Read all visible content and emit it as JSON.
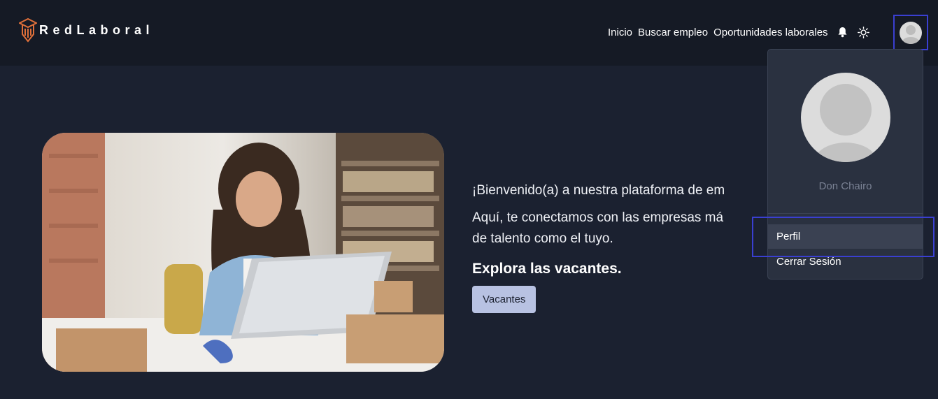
{
  "brand": {
    "name": "RedLaboral"
  },
  "nav": {
    "links": [
      "Inicio",
      "Buscar empleo",
      "Oportunidades laborales"
    ],
    "icons": [
      "bell-icon",
      "sun-icon"
    ]
  },
  "hero": {
    "line1": "¡Bienvenido(a) a nuestra plataforma de em",
    "line2": "Aquí, te conectamos con las empresas má",
    "line3": "de talento como el tuyo.",
    "heading": "Explora las vacantes.",
    "button_label": "Vacantes"
  },
  "user_menu": {
    "name": "Don Chairo",
    "items": [
      "Perfil",
      "Cerrar Sesión"
    ]
  },
  "colors": {
    "background": "#1b2130",
    "navbar": "#151a25",
    "brand_accent": "#e0703a",
    "button_bg": "#b8c2e2",
    "dropdown_bg": "#2a3140",
    "highlight_border": "#3a3fd1"
  }
}
